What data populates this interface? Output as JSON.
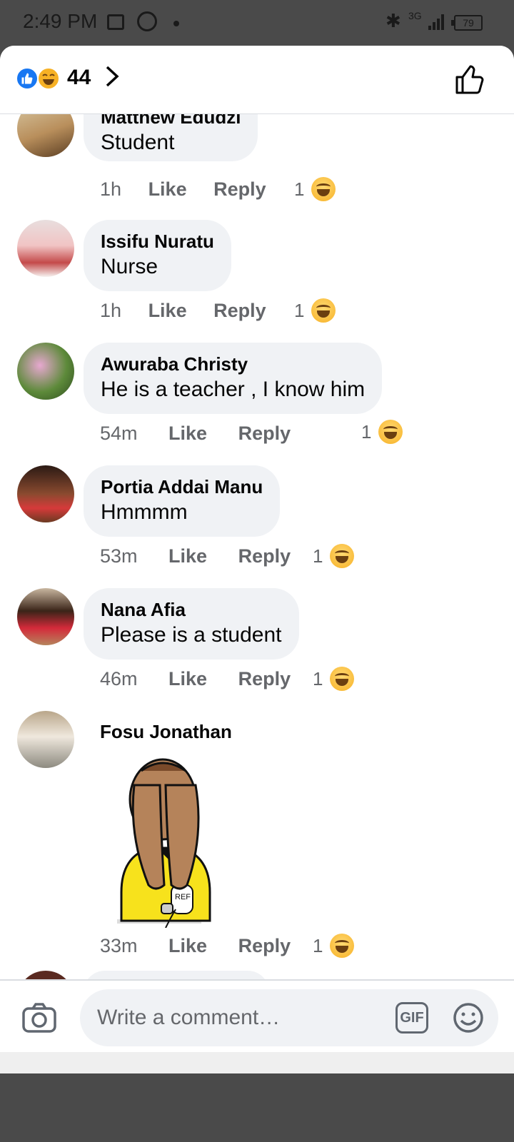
{
  "status_bar": {
    "time": "2:49 PM",
    "network": "3G",
    "battery": "79"
  },
  "reactions": {
    "count": "44"
  },
  "comments": [
    {
      "name": "Matthew Edudzi",
      "text": "Student",
      "time": "1h",
      "like": "Like",
      "reply": "Reply",
      "reaction_count": "1"
    },
    {
      "name": "Issifu Nuratu",
      "text": "Nurse",
      "time": "1h",
      "like": "Like",
      "reply": "Reply",
      "reaction_count": "1"
    },
    {
      "name": "Awuraba Christy",
      "text": "He is a teacher , I know him",
      "time": "54m",
      "like": "Like",
      "reply": "Reply",
      "reaction_count": "1"
    },
    {
      "name": "Portia Addai Manu",
      "text": "Hmmmm",
      "time": "53m",
      "like": "Like",
      "reply": "Reply",
      "reaction_count": "1"
    },
    {
      "name": "Nana Afia",
      "text": "Please is a student",
      "time": "46m",
      "like": "Like",
      "reply": "Reply",
      "reaction_count": "1"
    },
    {
      "name": "Fosu Jonathan",
      "sticker": "referee covering face sticker",
      "time": "33m",
      "like": "Like",
      "reply": "Reply",
      "reaction_count": "1"
    }
  ],
  "composer": {
    "placeholder": "Write a comment…",
    "gif_label": "GIF"
  },
  "colors": {
    "facebook_blue": "#1877f2",
    "haha_yellow": "#f7b125",
    "bubble_gray": "#f0f2f5",
    "meta_gray": "#65676b"
  }
}
